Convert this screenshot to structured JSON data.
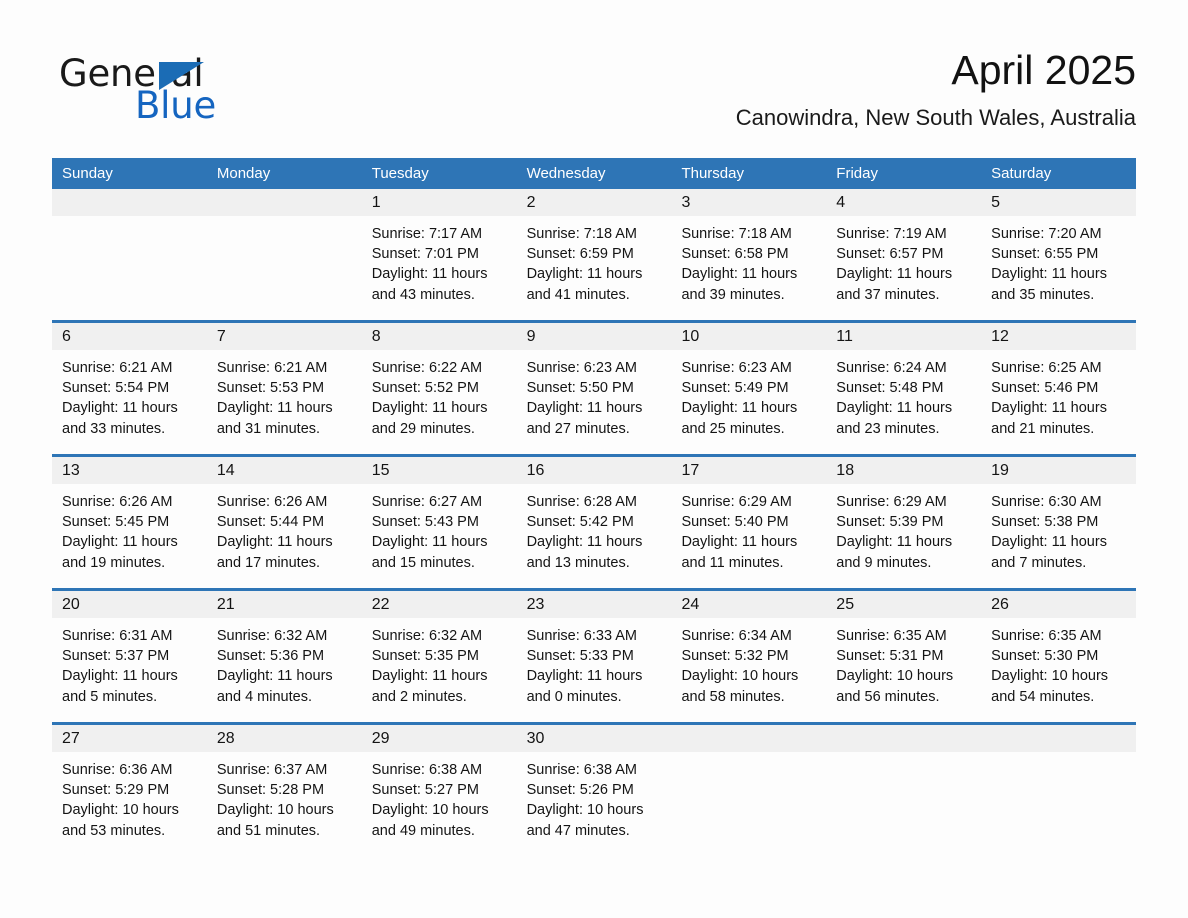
{
  "brand": {
    "line1": "General",
    "line2": "Blue",
    "triangle_color": "#1b6cb5"
  },
  "header": {
    "month_title": "April 2025",
    "location": "Canowindra, New South Wales, Australia"
  },
  "theme": {
    "header_blue": "#2e75b6",
    "daynum_row_bg": "#f0f0f0",
    "page_bg": "#fdfdfd",
    "text": "#141414"
  },
  "weekdays": [
    "Sunday",
    "Monday",
    "Tuesday",
    "Wednesday",
    "Thursday",
    "Friday",
    "Saturday"
  ],
  "weeks": [
    {
      "numbers": [
        "",
        "",
        "1",
        "2",
        "3",
        "4",
        "5"
      ],
      "cells": [
        {
          "empty": true
        },
        {
          "empty": true
        },
        {
          "empty": false,
          "sunrise": "Sunrise: 7:17 AM",
          "sunset": "Sunset: 7:01 PM",
          "daylight": "Daylight: 11 hours and 43 minutes."
        },
        {
          "empty": false,
          "sunrise": "Sunrise: 7:18 AM",
          "sunset": "Sunset: 6:59 PM",
          "daylight": "Daylight: 11 hours and 41 minutes."
        },
        {
          "empty": false,
          "sunrise": "Sunrise: 7:18 AM",
          "sunset": "Sunset: 6:58 PM",
          "daylight": "Daylight: 11 hours and 39 minutes."
        },
        {
          "empty": false,
          "sunrise": "Sunrise: 7:19 AM",
          "sunset": "Sunset: 6:57 PM",
          "daylight": "Daylight: 11 hours and 37 minutes."
        },
        {
          "empty": false,
          "sunrise": "Sunrise: 7:20 AM",
          "sunset": "Sunset: 6:55 PM",
          "daylight": "Daylight: 11 hours and 35 minutes."
        }
      ]
    },
    {
      "numbers": [
        "6",
        "7",
        "8",
        "9",
        "10",
        "11",
        "12"
      ],
      "cells": [
        {
          "empty": false,
          "sunrise": "Sunrise: 6:21 AM",
          "sunset": "Sunset: 5:54 PM",
          "daylight": "Daylight: 11 hours and 33 minutes."
        },
        {
          "empty": false,
          "sunrise": "Sunrise: 6:21 AM",
          "sunset": "Sunset: 5:53 PM",
          "daylight": "Daylight: 11 hours and 31 minutes."
        },
        {
          "empty": false,
          "sunrise": "Sunrise: 6:22 AM",
          "sunset": "Sunset: 5:52 PM",
          "daylight": "Daylight: 11 hours and 29 minutes."
        },
        {
          "empty": false,
          "sunrise": "Sunrise: 6:23 AM",
          "sunset": "Sunset: 5:50 PM",
          "daylight": "Daylight: 11 hours and 27 minutes."
        },
        {
          "empty": false,
          "sunrise": "Sunrise: 6:23 AM",
          "sunset": "Sunset: 5:49 PM",
          "daylight": "Daylight: 11 hours and 25 minutes."
        },
        {
          "empty": false,
          "sunrise": "Sunrise: 6:24 AM",
          "sunset": "Sunset: 5:48 PM",
          "daylight": "Daylight: 11 hours and 23 minutes."
        },
        {
          "empty": false,
          "sunrise": "Sunrise: 6:25 AM",
          "sunset": "Sunset: 5:46 PM",
          "daylight": "Daylight: 11 hours and 21 minutes."
        }
      ]
    },
    {
      "numbers": [
        "13",
        "14",
        "15",
        "16",
        "17",
        "18",
        "19"
      ],
      "cells": [
        {
          "empty": false,
          "sunrise": "Sunrise: 6:26 AM",
          "sunset": "Sunset: 5:45 PM",
          "daylight": "Daylight: 11 hours and 19 minutes."
        },
        {
          "empty": false,
          "sunrise": "Sunrise: 6:26 AM",
          "sunset": "Sunset: 5:44 PM",
          "daylight": "Daylight: 11 hours and 17 minutes."
        },
        {
          "empty": false,
          "sunrise": "Sunrise: 6:27 AM",
          "sunset": "Sunset: 5:43 PM",
          "daylight": "Daylight: 11 hours and 15 minutes."
        },
        {
          "empty": false,
          "sunrise": "Sunrise: 6:28 AM",
          "sunset": "Sunset: 5:42 PM",
          "daylight": "Daylight: 11 hours and 13 minutes."
        },
        {
          "empty": false,
          "sunrise": "Sunrise: 6:29 AM",
          "sunset": "Sunset: 5:40 PM",
          "daylight": "Daylight: 11 hours and 11 minutes."
        },
        {
          "empty": false,
          "sunrise": "Sunrise: 6:29 AM",
          "sunset": "Sunset: 5:39 PM",
          "daylight": "Daylight: 11 hours and 9 minutes."
        },
        {
          "empty": false,
          "sunrise": "Sunrise: 6:30 AM",
          "sunset": "Sunset: 5:38 PM",
          "daylight": "Daylight: 11 hours and 7 minutes."
        }
      ]
    },
    {
      "numbers": [
        "20",
        "21",
        "22",
        "23",
        "24",
        "25",
        "26"
      ],
      "cells": [
        {
          "empty": false,
          "sunrise": "Sunrise: 6:31 AM",
          "sunset": "Sunset: 5:37 PM",
          "daylight": "Daylight: 11 hours and 5 minutes."
        },
        {
          "empty": false,
          "sunrise": "Sunrise: 6:32 AM",
          "sunset": "Sunset: 5:36 PM",
          "daylight": "Daylight: 11 hours and 4 minutes."
        },
        {
          "empty": false,
          "sunrise": "Sunrise: 6:32 AM",
          "sunset": "Sunset: 5:35 PM",
          "daylight": "Daylight: 11 hours and 2 minutes."
        },
        {
          "empty": false,
          "sunrise": "Sunrise: 6:33 AM",
          "sunset": "Sunset: 5:33 PM",
          "daylight": "Daylight: 11 hours and 0 minutes."
        },
        {
          "empty": false,
          "sunrise": "Sunrise: 6:34 AM",
          "sunset": "Sunset: 5:32 PM",
          "daylight": "Daylight: 10 hours and 58 minutes."
        },
        {
          "empty": false,
          "sunrise": "Sunrise: 6:35 AM",
          "sunset": "Sunset: 5:31 PM",
          "daylight": "Daylight: 10 hours and 56 minutes."
        },
        {
          "empty": false,
          "sunrise": "Sunrise: 6:35 AM",
          "sunset": "Sunset: 5:30 PM",
          "daylight": "Daylight: 10 hours and 54 minutes."
        }
      ]
    },
    {
      "numbers": [
        "27",
        "28",
        "29",
        "30",
        "",
        "",
        ""
      ],
      "cells": [
        {
          "empty": false,
          "sunrise": "Sunrise: 6:36 AM",
          "sunset": "Sunset: 5:29 PM",
          "daylight": "Daylight: 10 hours and 53 minutes."
        },
        {
          "empty": false,
          "sunrise": "Sunrise: 6:37 AM",
          "sunset": "Sunset: 5:28 PM",
          "daylight": "Daylight: 10 hours and 51 minutes."
        },
        {
          "empty": false,
          "sunrise": "Sunrise: 6:38 AM",
          "sunset": "Sunset: 5:27 PM",
          "daylight": "Daylight: 10 hours and 49 minutes."
        },
        {
          "empty": false,
          "sunrise": "Sunrise: 6:38 AM",
          "sunset": "Sunset: 5:26 PM",
          "daylight": "Daylight: 10 hours and 47 minutes."
        },
        {
          "empty": true
        },
        {
          "empty": true
        },
        {
          "empty": true
        }
      ]
    }
  ]
}
